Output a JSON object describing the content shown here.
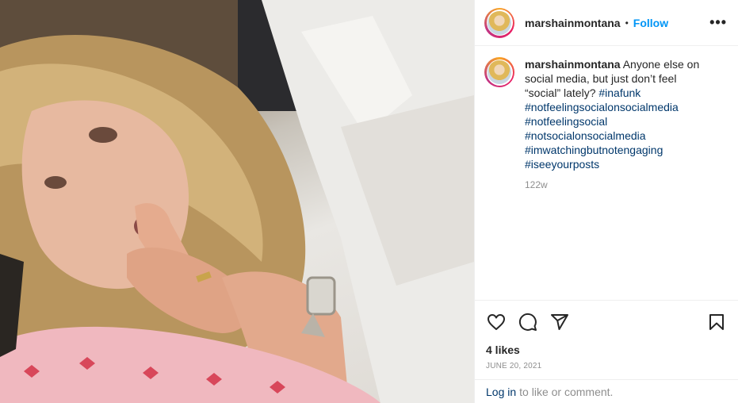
{
  "header": {
    "username": "marshainmontana",
    "separator": "•",
    "follow_label": "Follow",
    "more_label": "•••",
    "avatar_icon": "profile-avatar"
  },
  "caption": {
    "username": "marshainmontana",
    "text": "Anyone else on social media, but just don’t feel “social” lately?",
    "hashtags": [
      "#inafunk",
      "#notfeelingsocialonsocialmedia",
      "#notfeelingsocial",
      "#notsocialonsocialmedia",
      "#imwatchingbutnotengaging",
      "#iseeyourposts"
    ],
    "time_ago": "122w"
  },
  "actions": {
    "like_icon": "heart-icon",
    "comment_icon": "comment-icon",
    "share_icon": "share-icon",
    "save_icon": "bookmark-icon"
  },
  "likes": "4 likes",
  "date": "JUNE 20, 2021",
  "login": {
    "link_label": "Log in",
    "rest_text": "to like or comment."
  },
  "colors": {
    "link_blue": "#0095f6",
    "hashtag_blue": "#00376b",
    "muted": "#8e8e8e",
    "text": "#262626"
  }
}
